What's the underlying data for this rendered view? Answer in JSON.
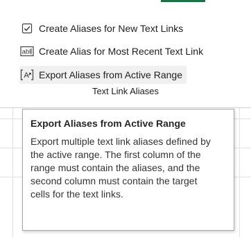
{
  "ribbon": {
    "commands": [
      {
        "label": "Create Aliases for New Text Links",
        "icon": "checkbox-checked-icon"
      },
      {
        "label": "Create Alias for Most Recent Text Link",
        "icon": "text-field-abl-icon"
      },
      {
        "label": "Export Aliases from Active Range",
        "icon": "export-range-icon"
      }
    ],
    "group_label": "Text Link Aliases",
    "icon_text_abl": "abl",
    "icon_text_a": "A"
  },
  "tooltip": {
    "title": "Export Aliases from Active Range",
    "description": "Export multiple text link aliases defined by the active range. The first column of the range must contain the aliases, and the second column must contain the target cells for the text links."
  },
  "colors": {
    "accent_tab": "#1e7145",
    "hover_background": "#f0f0f0",
    "tooltip_border": "#a6a6a6"
  }
}
